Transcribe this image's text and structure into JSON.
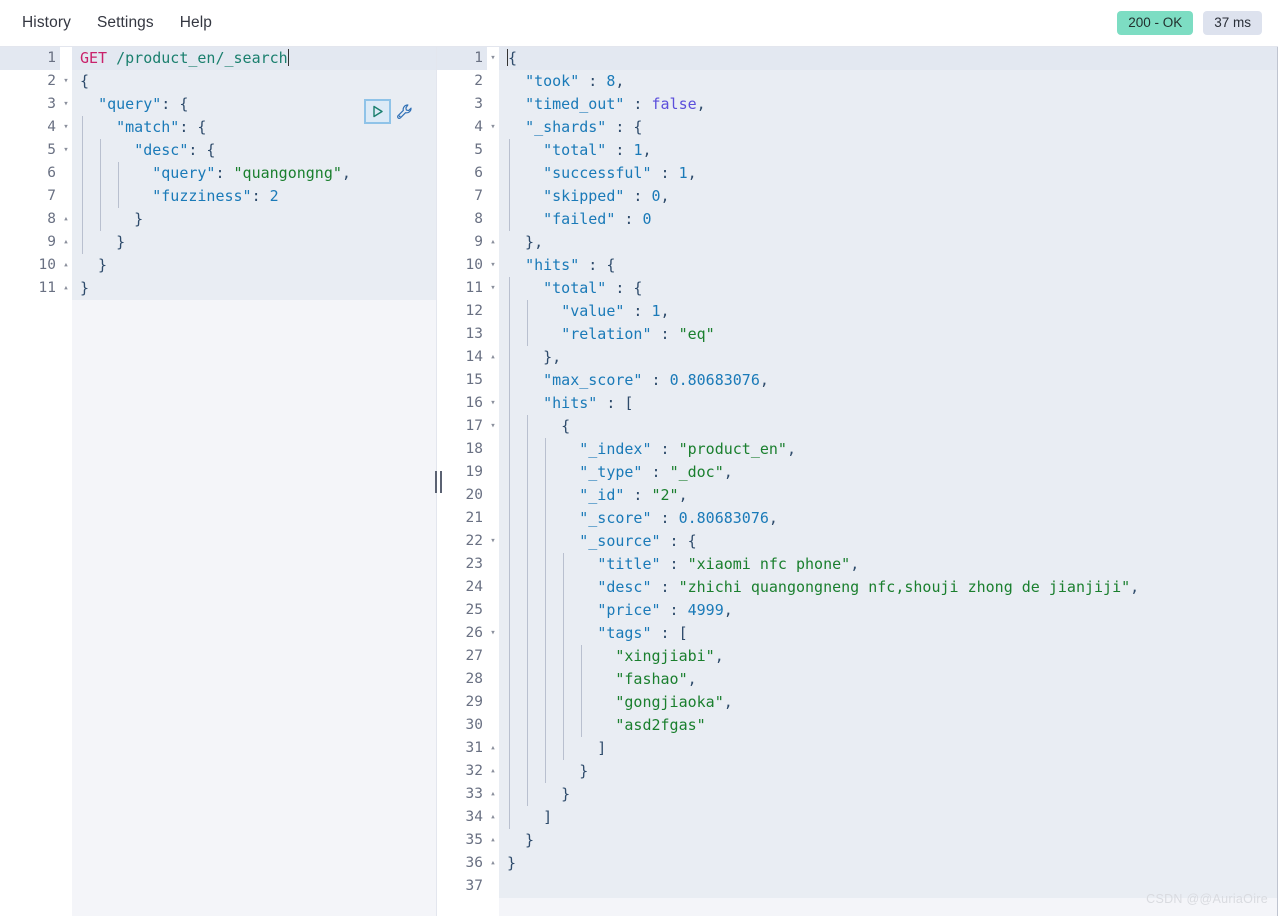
{
  "menu": {
    "items": [
      {
        "label": "History",
        "name": "menu-history"
      },
      {
        "label": "Settings",
        "name": "menu-settings"
      },
      {
        "label": "Help",
        "name": "menu-help"
      }
    ]
  },
  "status": {
    "code_label": "200 - OK",
    "time_label": "37 ms",
    "ok_color": "#7dddc3",
    "time_color": "#dde2ee"
  },
  "toolbar": {
    "run_icon": "play-triangle-icon",
    "wrench_icon": "wrench-icon"
  },
  "request_editor": {
    "name": "request-editor",
    "active_line": 1,
    "lines": [
      {
        "n": 1,
        "fold": "",
        "indent": 0,
        "tokens": [
          {
            "t": "GET",
            "c": "k-method"
          },
          {
            "t": " ",
            "c": "k-plain"
          },
          {
            "t": "/product_en/_search",
            "c": "k-url"
          },
          {
            "t": "CARET",
            "c": "caret"
          }
        ]
      },
      {
        "n": 2,
        "fold": "▾",
        "indent": 0,
        "tokens": [
          {
            "t": "{",
            "c": "k-punc"
          }
        ]
      },
      {
        "n": 3,
        "fold": "▾",
        "indent": 0,
        "tokens": [
          {
            "t": "  ",
            "c": "k-plain"
          },
          {
            "t": "\"query\"",
            "c": "k-key"
          },
          {
            "t": ": {",
            "c": "k-punc"
          }
        ]
      },
      {
        "n": 4,
        "fold": "▾",
        "indent": 1,
        "tokens": [
          {
            "t": "    ",
            "c": "k-plain"
          },
          {
            "t": "\"match\"",
            "c": "k-key"
          },
          {
            "t": ": {",
            "c": "k-punc"
          }
        ]
      },
      {
        "n": 5,
        "fold": "▾",
        "indent": 2,
        "tokens": [
          {
            "t": "      ",
            "c": "k-plain"
          },
          {
            "t": "\"desc\"",
            "c": "k-key"
          },
          {
            "t": ": {",
            "c": "k-punc"
          }
        ]
      },
      {
        "n": 6,
        "fold": "",
        "indent": 3,
        "tokens": [
          {
            "t": "        ",
            "c": "k-plain"
          },
          {
            "t": "\"query\"",
            "c": "k-key"
          },
          {
            "t": ": ",
            "c": "k-punc"
          },
          {
            "t": "\"quangongng\"",
            "c": "k-str"
          },
          {
            "t": ",",
            "c": "k-punc"
          }
        ]
      },
      {
        "n": 7,
        "fold": "",
        "indent": 3,
        "tokens": [
          {
            "t": "        ",
            "c": "k-plain"
          },
          {
            "t": "\"fuzziness\"",
            "c": "k-key"
          },
          {
            "t": ": ",
            "c": "k-punc"
          },
          {
            "t": "2",
            "c": "k-num"
          }
        ]
      },
      {
        "n": 8,
        "fold": "▴",
        "indent": 2,
        "tokens": [
          {
            "t": "      }",
            "c": "k-punc"
          }
        ]
      },
      {
        "n": 9,
        "fold": "▴",
        "indent": 1,
        "tokens": [
          {
            "t": "    }",
            "c": "k-punc"
          }
        ]
      },
      {
        "n": 10,
        "fold": "▴",
        "indent": 0,
        "tokens": [
          {
            "t": "  }",
            "c": "k-punc"
          }
        ]
      },
      {
        "n": 11,
        "fold": "▴",
        "indent": 0,
        "tokens": [
          {
            "t": "}",
            "c": "k-punc"
          }
        ]
      }
    ]
  },
  "response_editor": {
    "name": "response-editor",
    "active_line": 1,
    "lines": [
      {
        "n": 1,
        "fold": "▾",
        "indent": 0,
        "tokens": [
          {
            "t": "CARET",
            "c": "caret"
          },
          {
            "t": "{",
            "c": "k-punc"
          }
        ]
      },
      {
        "n": 2,
        "fold": "",
        "indent": 0,
        "tokens": [
          {
            "t": "  ",
            "c": "k-plain"
          },
          {
            "t": "\"took\"",
            "c": "k-key"
          },
          {
            "t": " : ",
            "c": "k-punc"
          },
          {
            "t": "8",
            "c": "k-num"
          },
          {
            "t": ",",
            "c": "k-punc"
          }
        ]
      },
      {
        "n": 3,
        "fold": "",
        "indent": 0,
        "tokens": [
          {
            "t": "  ",
            "c": "k-plain"
          },
          {
            "t": "\"timed_out\"",
            "c": "k-key"
          },
          {
            "t": " : ",
            "c": "k-punc"
          },
          {
            "t": "false",
            "c": "k-bool"
          },
          {
            "t": ",",
            "c": "k-punc"
          }
        ]
      },
      {
        "n": 4,
        "fold": "▾",
        "indent": 0,
        "tokens": [
          {
            "t": "  ",
            "c": "k-plain"
          },
          {
            "t": "\"_shards\"",
            "c": "k-key"
          },
          {
            "t": " : {",
            "c": "k-punc"
          }
        ]
      },
      {
        "n": 5,
        "fold": "",
        "indent": 1,
        "tokens": [
          {
            "t": "    ",
            "c": "k-plain"
          },
          {
            "t": "\"total\"",
            "c": "k-key"
          },
          {
            "t": " : ",
            "c": "k-punc"
          },
          {
            "t": "1",
            "c": "k-num"
          },
          {
            "t": ",",
            "c": "k-punc"
          }
        ]
      },
      {
        "n": 6,
        "fold": "",
        "indent": 1,
        "tokens": [
          {
            "t": "    ",
            "c": "k-plain"
          },
          {
            "t": "\"successful\"",
            "c": "k-key"
          },
          {
            "t": " : ",
            "c": "k-punc"
          },
          {
            "t": "1",
            "c": "k-num"
          },
          {
            "t": ",",
            "c": "k-punc"
          }
        ]
      },
      {
        "n": 7,
        "fold": "",
        "indent": 1,
        "tokens": [
          {
            "t": "    ",
            "c": "k-plain"
          },
          {
            "t": "\"skipped\"",
            "c": "k-key"
          },
          {
            "t": " : ",
            "c": "k-punc"
          },
          {
            "t": "0",
            "c": "k-num"
          },
          {
            "t": ",",
            "c": "k-punc"
          }
        ]
      },
      {
        "n": 8,
        "fold": "",
        "indent": 1,
        "tokens": [
          {
            "t": "    ",
            "c": "k-plain"
          },
          {
            "t": "\"failed\"",
            "c": "k-key"
          },
          {
            "t": " : ",
            "c": "k-punc"
          },
          {
            "t": "0",
            "c": "k-num"
          }
        ]
      },
      {
        "n": 9,
        "fold": "▴",
        "indent": 0,
        "tokens": [
          {
            "t": "  },",
            "c": "k-punc"
          }
        ]
      },
      {
        "n": 10,
        "fold": "▾",
        "indent": 0,
        "tokens": [
          {
            "t": "  ",
            "c": "k-plain"
          },
          {
            "t": "\"hits\"",
            "c": "k-key"
          },
          {
            "t": " : {",
            "c": "k-punc"
          }
        ]
      },
      {
        "n": 11,
        "fold": "▾",
        "indent": 1,
        "tokens": [
          {
            "t": "    ",
            "c": "k-plain"
          },
          {
            "t": "\"total\"",
            "c": "k-key"
          },
          {
            "t": " : {",
            "c": "k-punc"
          }
        ]
      },
      {
        "n": 12,
        "fold": "",
        "indent": 2,
        "tokens": [
          {
            "t": "      ",
            "c": "k-plain"
          },
          {
            "t": "\"value\"",
            "c": "k-key"
          },
          {
            "t": " : ",
            "c": "k-punc"
          },
          {
            "t": "1",
            "c": "k-num"
          },
          {
            "t": ",",
            "c": "k-punc"
          }
        ]
      },
      {
        "n": 13,
        "fold": "",
        "indent": 2,
        "tokens": [
          {
            "t": "      ",
            "c": "k-plain"
          },
          {
            "t": "\"relation\"",
            "c": "k-key"
          },
          {
            "t": " : ",
            "c": "k-punc"
          },
          {
            "t": "\"eq\"",
            "c": "k-str"
          }
        ]
      },
      {
        "n": 14,
        "fold": "▴",
        "indent": 1,
        "tokens": [
          {
            "t": "    },",
            "c": "k-punc"
          }
        ]
      },
      {
        "n": 15,
        "fold": "",
        "indent": 1,
        "tokens": [
          {
            "t": "    ",
            "c": "k-plain"
          },
          {
            "t": "\"max_score\"",
            "c": "k-key"
          },
          {
            "t": " : ",
            "c": "k-punc"
          },
          {
            "t": "0.80683076",
            "c": "k-num"
          },
          {
            "t": ",",
            "c": "k-punc"
          }
        ]
      },
      {
        "n": 16,
        "fold": "▾",
        "indent": 1,
        "tokens": [
          {
            "t": "    ",
            "c": "k-plain"
          },
          {
            "t": "\"hits\"",
            "c": "k-key"
          },
          {
            "t": " : [",
            "c": "k-punc"
          }
        ]
      },
      {
        "n": 17,
        "fold": "▾",
        "indent": 2,
        "tokens": [
          {
            "t": "      {",
            "c": "k-punc"
          }
        ]
      },
      {
        "n": 18,
        "fold": "",
        "indent": 3,
        "tokens": [
          {
            "t": "        ",
            "c": "k-plain"
          },
          {
            "t": "\"_index\"",
            "c": "k-key"
          },
          {
            "t": " : ",
            "c": "k-punc"
          },
          {
            "t": "\"product_en\"",
            "c": "k-str"
          },
          {
            "t": ",",
            "c": "k-punc"
          }
        ]
      },
      {
        "n": 19,
        "fold": "",
        "indent": 3,
        "tokens": [
          {
            "t": "        ",
            "c": "k-plain"
          },
          {
            "t": "\"_type\"",
            "c": "k-key"
          },
          {
            "t": " : ",
            "c": "k-punc"
          },
          {
            "t": "\"_doc\"",
            "c": "k-str"
          },
          {
            "t": ",",
            "c": "k-punc"
          }
        ]
      },
      {
        "n": 20,
        "fold": "",
        "indent": 3,
        "tokens": [
          {
            "t": "        ",
            "c": "k-plain"
          },
          {
            "t": "\"_id\"",
            "c": "k-key"
          },
          {
            "t": " : ",
            "c": "k-punc"
          },
          {
            "t": "\"2\"",
            "c": "k-str"
          },
          {
            "t": ",",
            "c": "k-punc"
          }
        ]
      },
      {
        "n": 21,
        "fold": "",
        "indent": 3,
        "tokens": [
          {
            "t": "        ",
            "c": "k-plain"
          },
          {
            "t": "\"_score\"",
            "c": "k-key"
          },
          {
            "t": " : ",
            "c": "k-punc"
          },
          {
            "t": "0.80683076",
            "c": "k-num"
          },
          {
            "t": ",",
            "c": "k-punc"
          }
        ]
      },
      {
        "n": 22,
        "fold": "▾",
        "indent": 3,
        "tokens": [
          {
            "t": "        ",
            "c": "k-plain"
          },
          {
            "t": "\"_source\"",
            "c": "k-key"
          },
          {
            "t": " : {",
            "c": "k-punc"
          }
        ]
      },
      {
        "n": 23,
        "fold": "",
        "indent": 4,
        "tokens": [
          {
            "t": "          ",
            "c": "k-plain"
          },
          {
            "t": "\"title\"",
            "c": "k-key"
          },
          {
            "t": " : ",
            "c": "k-punc"
          },
          {
            "t": "\"xiaomi nfc phone\"",
            "c": "k-str"
          },
          {
            "t": ",",
            "c": "k-punc"
          }
        ]
      },
      {
        "n": 24,
        "fold": "",
        "indent": 4,
        "tokens": [
          {
            "t": "          ",
            "c": "k-plain"
          },
          {
            "t": "\"desc\"",
            "c": "k-key"
          },
          {
            "t": " : ",
            "c": "k-punc"
          },
          {
            "t": "\"zhichi quangongneng nfc,shouji zhong de jianjiji\"",
            "c": "k-str"
          },
          {
            "t": ",",
            "c": "k-punc"
          }
        ]
      },
      {
        "n": 25,
        "fold": "",
        "indent": 4,
        "tokens": [
          {
            "t": "          ",
            "c": "k-plain"
          },
          {
            "t": "\"price\"",
            "c": "k-key"
          },
          {
            "t": " : ",
            "c": "k-punc"
          },
          {
            "t": "4999",
            "c": "k-num"
          },
          {
            "t": ",",
            "c": "k-punc"
          }
        ]
      },
      {
        "n": 26,
        "fold": "▾",
        "indent": 4,
        "tokens": [
          {
            "t": "          ",
            "c": "k-plain"
          },
          {
            "t": "\"tags\"",
            "c": "k-key"
          },
          {
            "t": " : [",
            "c": "k-punc"
          }
        ]
      },
      {
        "n": 27,
        "fold": "",
        "indent": 5,
        "tokens": [
          {
            "t": "            ",
            "c": "k-plain"
          },
          {
            "t": "\"xingjiabi\"",
            "c": "k-str"
          },
          {
            "t": ",",
            "c": "k-punc"
          }
        ]
      },
      {
        "n": 28,
        "fold": "",
        "indent": 5,
        "tokens": [
          {
            "t": "            ",
            "c": "k-plain"
          },
          {
            "t": "\"fashao\"",
            "c": "k-str"
          },
          {
            "t": ",",
            "c": "k-punc"
          }
        ]
      },
      {
        "n": 29,
        "fold": "",
        "indent": 5,
        "tokens": [
          {
            "t": "            ",
            "c": "k-plain"
          },
          {
            "t": "\"gongjiaoka\"",
            "c": "k-str"
          },
          {
            "t": ",",
            "c": "k-punc"
          }
        ]
      },
      {
        "n": 30,
        "fold": "",
        "indent": 5,
        "tokens": [
          {
            "t": "            ",
            "c": "k-plain"
          },
          {
            "t": "\"asd2fgas\"",
            "c": "k-str"
          }
        ]
      },
      {
        "n": 31,
        "fold": "▴",
        "indent": 4,
        "tokens": [
          {
            "t": "          ]",
            "c": "k-punc"
          }
        ]
      },
      {
        "n": 32,
        "fold": "▴",
        "indent": 3,
        "tokens": [
          {
            "t": "        }",
            "c": "k-punc"
          }
        ]
      },
      {
        "n": 33,
        "fold": "▴",
        "indent": 2,
        "tokens": [
          {
            "t": "      }",
            "c": "k-punc"
          }
        ]
      },
      {
        "n": 34,
        "fold": "▴",
        "indent": 1,
        "tokens": [
          {
            "t": "    ]",
            "c": "k-punc"
          }
        ]
      },
      {
        "n": 35,
        "fold": "▴",
        "indent": 0,
        "tokens": [
          {
            "t": "  }",
            "c": "k-punc"
          }
        ]
      },
      {
        "n": 36,
        "fold": "▴",
        "indent": 0,
        "tokens": [
          {
            "t": "}",
            "c": "k-punc"
          }
        ]
      },
      {
        "n": 37,
        "fold": "",
        "indent": 0,
        "tokens": []
      }
    ]
  },
  "splitter": {
    "name": "pane-splitter"
  },
  "watermark": {
    "text": "CSDN @@AuriaOire"
  }
}
